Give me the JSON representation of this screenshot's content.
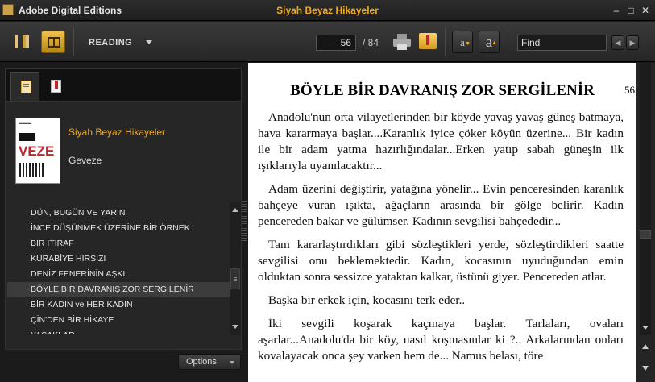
{
  "window": {
    "app_title": "Adobe Digital Editions",
    "doc_title": "Siyah Beyaz Hikayeler",
    "minimize": "–",
    "maximize": "□",
    "close": "✕"
  },
  "toolbar": {
    "mode_label": "READING",
    "current_page": "56",
    "total_pages": "/ 84",
    "font_small": "a",
    "font_large": "a",
    "find_placeholder": "Find",
    "prev": "◀",
    "next": "▶"
  },
  "sidebar": {
    "book": {
      "title": "Siyah Beyaz Hikayeler",
      "author": "Geveze",
      "cover_text": "VEZE"
    },
    "toc": [
      {
        "label": "DÜN, BUGÜN VE YARIN"
      },
      {
        "label": "İNCE DÜŞÜNMEK ÜZERİNE BİR ÖRNEK"
      },
      {
        "label": "BİR İTİRAF"
      },
      {
        "label": "KURABİYE HIRSIZI"
      },
      {
        "label": "DENİZ FENERİNİN AŞKI"
      },
      {
        "label": "BÖYLE BİR DAVRANIŞ ZOR SERGİLENİR"
      },
      {
        "label": "BİR KADIN ve HER KADIN"
      },
      {
        "label": "ÇİN'DEN BİR HİKAYE"
      },
      {
        "label": "YASAKLAR"
      }
    ],
    "selected_index": 5,
    "options_label": "Options"
  },
  "page": {
    "chapter_title": "BÖYLE BİR DAVRANIŞ ZOR SERGİLENİR",
    "page_number": "56",
    "paragraphs": [
      "Anadolu'nun orta vilayetlerinden bir köyde yavaş yavaş güneş batmaya, hava kararmaya başlar....Karanlık iyice çöker köyün üzerine... Bir kadın ile bir adam yatma hazırlığındalar...Erken yatıp sabah güneşin ilk ışıklarıyla uyanılacaktır...",
      "Adam üzerini değiştirir, yatağına yönelir... Evin penceresinden karanlık bahçeye vuran ışıkta, ağaçların arasında bir gölge belirir. Kadın pencereden bakar ve gülümser. Kadının sevgilisi bahçededir...",
      "Tam kararlaştırdıkları gibi sözleştikleri yerde, sözleştirdikleri saatte sevgilisi onu beklemektedir. Kadın, kocasının uyuduğundan emin olduktan sonra sessizce yataktan kalkar, üstünü giyer. Pencereden atlar.",
      "Başka bir erkek için, kocasını terk eder..",
      "İki sevgili koşarak kaçmaya başlar. Tarlaları, ovaları aşarlar...Anadolu'da bir köy, nasıl koşmasınlar ki ?.. Arkalarından onları kovalayacak onca şey varken hem de... Namus belası, töre"
    ]
  }
}
